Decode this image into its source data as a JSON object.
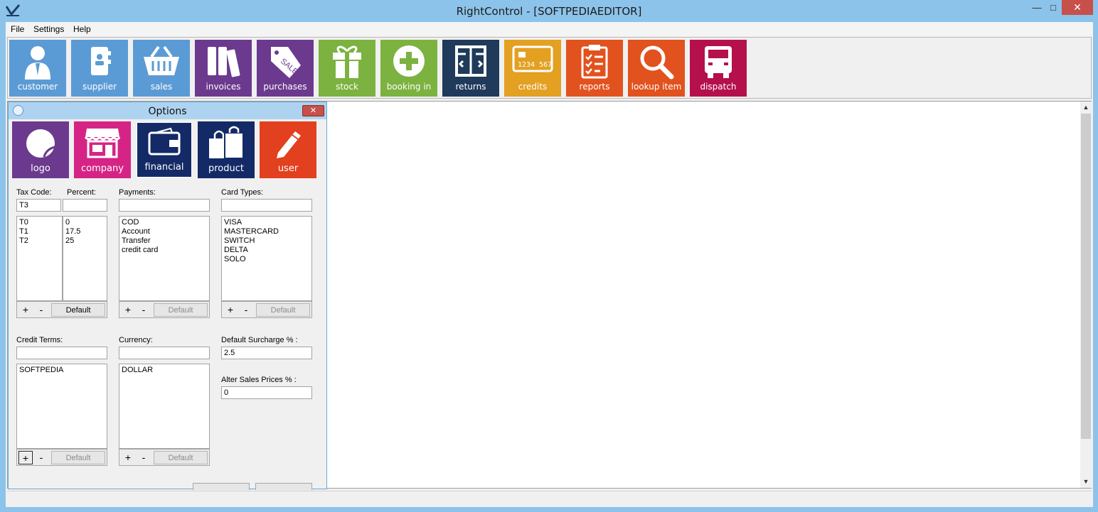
{
  "window": {
    "title": "RightControl - [SOFTPEDIAEDITOR]",
    "minimize": "—",
    "maximize": "□",
    "close": "✕"
  },
  "menu": [
    "File",
    "Settings",
    "Help"
  ],
  "toolbar": [
    {
      "label": "customer",
      "color": "#5b9bd5",
      "icon": "customer-icon"
    },
    {
      "label": "supplier",
      "color": "#5b9bd5",
      "icon": "supplier-icon"
    },
    {
      "label": "sales",
      "color": "#5b9bd5",
      "icon": "basket-icon"
    },
    {
      "label": "invoices",
      "color": "#6b3a8e",
      "icon": "binders-icon"
    },
    {
      "label": "purchases",
      "color": "#6b3a8e",
      "icon": "sale-tag-icon"
    },
    {
      "label": "stock",
      "color": "#7cb23f",
      "icon": "gift-icon"
    },
    {
      "label": "booking in",
      "color": "#7cb23f",
      "icon": "plus-circle-icon"
    },
    {
      "label": "returns",
      "color": "#1f3a5a",
      "icon": "box-icon"
    },
    {
      "label": "credits",
      "color": "#e3a021",
      "icon": "card-icon"
    },
    {
      "label": "reports",
      "color": "#e2521e",
      "icon": "clipboard-icon"
    },
    {
      "label": "lookup item",
      "color": "#e2521e",
      "icon": "magnifier-icon"
    },
    {
      "label": "dispatch",
      "color": "#b5104c",
      "icon": "truck-icon"
    }
  ],
  "options": {
    "title": "Options",
    "close": "✕",
    "tabs": [
      {
        "label": "logo",
        "color": "#6b3a8e"
      },
      {
        "label": "company",
        "color": "#d52485"
      },
      {
        "label": "financial",
        "color": "#132a66"
      },
      {
        "label": "product",
        "color": "#132a66"
      },
      {
        "label": "user",
        "color": "#e2401e"
      }
    ],
    "tax_code": {
      "label": "Tax Code:",
      "percent_label": "Percent:",
      "code_value": "T3",
      "percent_value": "",
      "codes": [
        "T0",
        "T1",
        "T2"
      ],
      "percents": [
        "0",
        "17.5",
        "25"
      ],
      "add": "+",
      "remove": "-",
      "default": "Default"
    },
    "payments": {
      "label": "Payments:",
      "value": "",
      "items": [
        "COD",
        "Account",
        "Transfer",
        "credit card"
      ],
      "add": "+",
      "remove": "-",
      "default": "Default"
    },
    "card_types": {
      "label": "Card Types:",
      "value": "",
      "items": [
        "VISA",
        "MASTERCARD",
        "SWITCH",
        "DELTA",
        "SOLO"
      ],
      "add": "+",
      "remove": "-",
      "default": "Default"
    },
    "credit_terms": {
      "label": "Credit Terms:",
      "value": "",
      "items": [
        "SOFTPEDIA"
      ],
      "add": "+",
      "remove": "-",
      "default": "Default"
    },
    "currency": {
      "label": "Currency:",
      "value": "",
      "items": [
        "DOLLAR"
      ],
      "add": "+",
      "remove": "-",
      "default": "Default"
    },
    "default_surcharge": {
      "label": "Default Surcharge % :",
      "value": "2.5"
    },
    "alter_sales_prices": {
      "label": "Alter Sales Prices % :",
      "value": "0"
    }
  },
  "scroll": {
    "up": "▲",
    "down": "▼"
  }
}
